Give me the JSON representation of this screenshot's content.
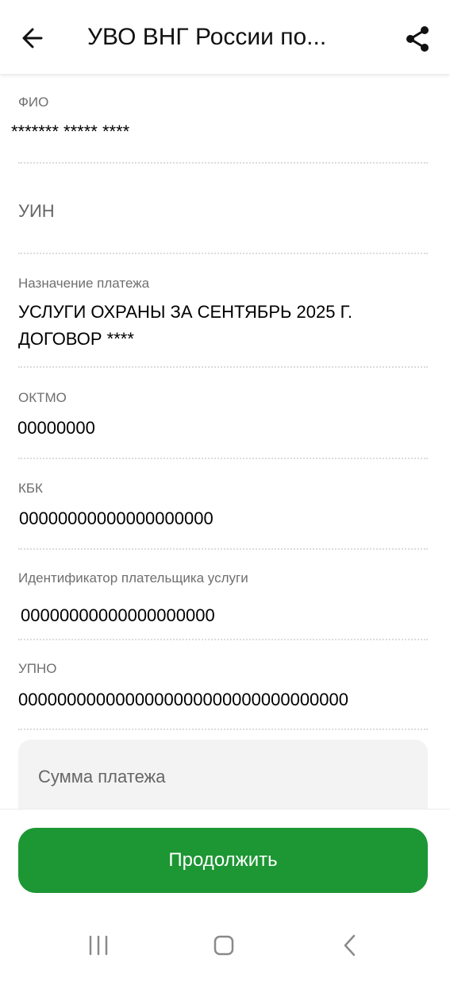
{
  "header": {
    "title": "УВО ВНГ России по...",
    "back_icon": "arrow-left-icon",
    "share_icon": "share-icon"
  },
  "fields": {
    "fio": {
      "label": "ФИО",
      "value": "******* ***** ****"
    },
    "uin": {
      "label": "УИН"
    },
    "purpose": {
      "label": "Назначение платежа",
      "value": "УСЛУГИ ОХРАНЫ ЗА СЕНТЯБРЬ 2025 Г. ДОГОВОР ****"
    },
    "oktmo": {
      "label": "ОКТМО",
      "value": "00000000"
    },
    "kbk": {
      "label": "КБК",
      "value": "00000000000000000000"
    },
    "payer_id": {
      "label": "Идентификатор плательщика услуги",
      "value": "00000000000000000000"
    },
    "upno": {
      "label": "УПНО",
      "value": "0000000000000000000000000000000000"
    }
  },
  "amount": {
    "placeholder": "Сумма платежа"
  },
  "actions": {
    "continue_label": "Продолжить"
  },
  "colors": {
    "primary": "#1d9634",
    "input_bg": "#f3f3f3"
  },
  "system_nav": {
    "recents_icon": "recents-icon",
    "home_icon": "home-icon",
    "back_icon": "back-chevron-icon"
  }
}
